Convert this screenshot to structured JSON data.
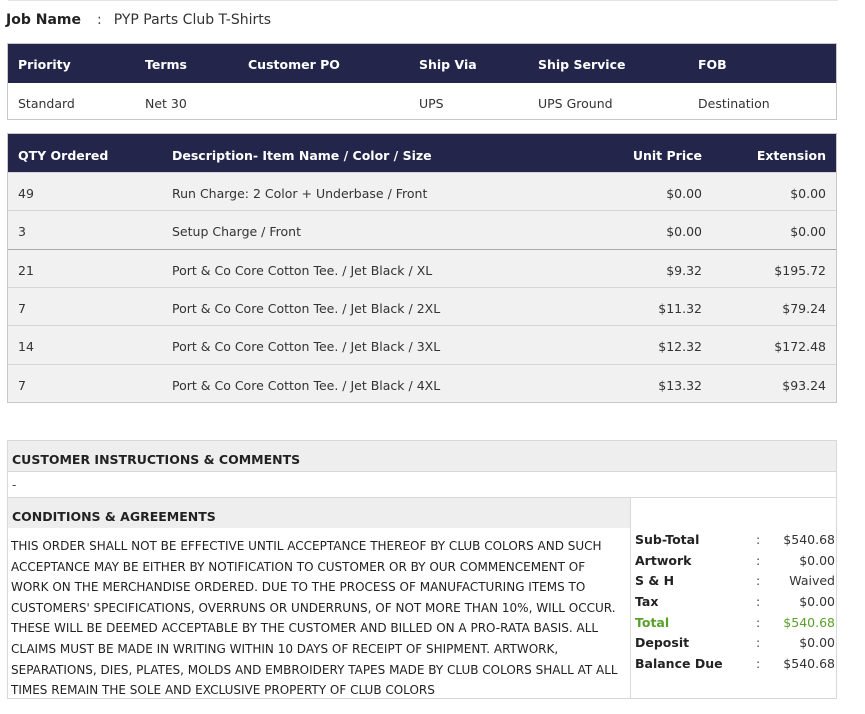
{
  "job": {
    "label": "Job Name",
    "separator": ":",
    "value": "PYP Parts Club T-Shirts"
  },
  "shipping": {
    "headers": {
      "priority": "Priority",
      "terms": "Terms",
      "customer_po": "Customer PO",
      "ship_via": "Ship Via",
      "ship_service": "Ship Service",
      "fob": "FOB"
    },
    "values": {
      "priority": "Standard",
      "terms": "Net 30",
      "customer_po": "",
      "ship_via": "UPS",
      "ship_service": "UPS Ground",
      "fob": "Destination"
    }
  },
  "items": {
    "headers": {
      "qty": "QTY Ordered",
      "desc": "Description- Item Name / Color / Size",
      "unit": "Unit Price",
      "ext": "Extension"
    },
    "rows": [
      {
        "qty": "49",
        "desc": "Run Charge: 2 Color + Underbase / Front",
        "unit": "$0.00",
        "ext": "$0.00"
      },
      {
        "qty": "3",
        "desc": "Setup Charge / Front",
        "unit": "$0.00",
        "ext": "$0.00"
      },
      {
        "qty": "21",
        "desc": "Port & Co Core Cotton Tee. / Jet Black / XL",
        "unit": "$9.32",
        "ext": "$195.72"
      },
      {
        "qty": "7",
        "desc": "Port & Co Core Cotton Tee. / Jet Black / 2XL",
        "unit": "$11.32",
        "ext": "$79.24"
      },
      {
        "qty": "14",
        "desc": "Port & Co Core Cotton Tee. / Jet Black / 3XL",
        "unit": "$12.32",
        "ext": "$172.48"
      },
      {
        "qty": "7",
        "desc": "Port & Co Core Cotton Tee. / Jet Black / 4XL",
        "unit": "$13.32",
        "ext": "$93.24"
      }
    ]
  },
  "instructions": {
    "title": "CUSTOMER INSTRUCTIONS & COMMENTS",
    "body": "-"
  },
  "conditions": {
    "title": "CONDITIONS & AGREEMENTS",
    "text": "THIS ORDER SHALL NOT BE EFFECTIVE UNTIL ACCEPTANCE THEREOF BY CLUB COLORS AND SUCH ACCEPTANCE MAY BE EITHER BY NOTIFICATION TO CUSTOMER OR BY OUR COMMENCEMENT OF WORK ON THE MERCHANDISE ORDERED. DUE TO THE PROCESS OF MANUFACTURING ITEMS TO CUSTOMERS' SPECIFICATIONS, OVERRUNS OR UNDERRUNS, OF NOT MORE THAN 10%, WILL OCCUR. THESE WILL BE DEEMED ACCEPTABLE BY THE CUSTOMER AND BILLED ON A PRO-RATA BASIS. ALL CLAIMS MUST BE MADE IN WRITING WITHIN 10 DAYS OF RECEIPT OF SHIPMENT. ARTWORK, SEPARATIONS, DIES, PLATES, MOLDS AND EMBROIDERY TAPES MADE BY CLUB COLORS SHALL AT ALL TIMES REMAIN THE SOLE AND EXCLUSIVE PROPERTY OF CLUB COLORS"
  },
  "totals": [
    {
      "label": "Sub-Total",
      "colon": ":",
      "value": "$540.68"
    },
    {
      "label": "Artwork",
      "colon": ":",
      "value": "$0.00"
    },
    {
      "label": "S & H",
      "colon": ":",
      "value": "Waived"
    },
    {
      "label": "Tax",
      "colon": ":",
      "value": "$0.00"
    },
    {
      "label": "Total",
      "colon": ":",
      "value": "$540.68"
    },
    {
      "label": "Deposit",
      "colon": ":",
      "value": "$0.00"
    },
    {
      "label": "Balance Due",
      "colon": ":",
      "value": "$540.68"
    }
  ],
  "colors": {
    "header_bg": "#23264a",
    "total_green": "#5aa02c"
  }
}
